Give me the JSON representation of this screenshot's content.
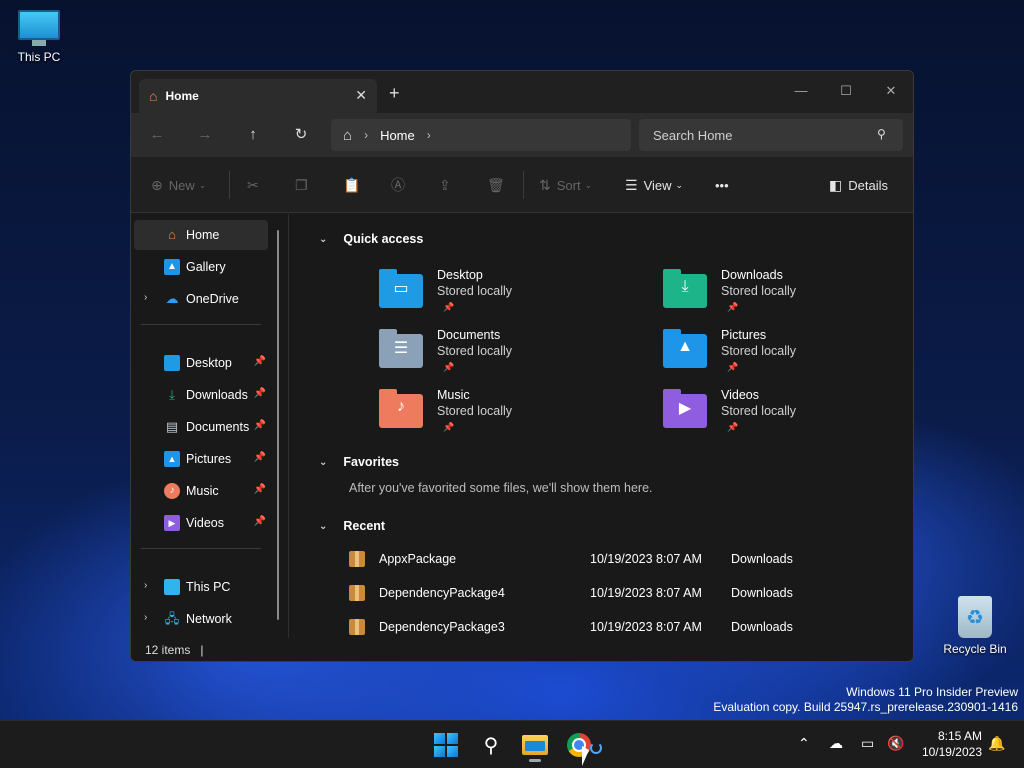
{
  "desktop": {
    "this_pc_label": "This PC",
    "recycle_bin_label": "Recycle Bin",
    "watermark_line1": "Windows 11 Pro Insider Preview",
    "watermark_line2": "Evaluation copy. Build 25947.rs_prerelease.230901-1416"
  },
  "window": {
    "tab_title": "Home",
    "tab_close_glyph": "✕",
    "new_tab_glyph": "+",
    "address": {
      "crumb": "Home"
    },
    "search": {
      "placeholder": "Search Home"
    }
  },
  "toolbar": {
    "new_label": "New",
    "sort_label": "Sort",
    "view_label": "View",
    "more_label": "•••",
    "details_label": "Details"
  },
  "navpane": {
    "top": [
      {
        "label": "Home",
        "icon": "home-icon"
      },
      {
        "label": "Gallery",
        "icon": "gallery-icon"
      },
      {
        "label": "OneDrive",
        "icon": "onedrive-icon"
      }
    ],
    "pinned": [
      {
        "label": "Desktop",
        "icon": "desktop-folder-icon"
      },
      {
        "label": "Downloads",
        "icon": "downloads-folder-icon"
      },
      {
        "label": "Documents",
        "icon": "documents-folder-icon"
      },
      {
        "label": "Pictures",
        "icon": "pictures-folder-icon"
      },
      {
        "label": "Music",
        "icon": "music-folder-icon"
      },
      {
        "label": "Videos",
        "icon": "videos-folder-icon"
      }
    ],
    "bottom": [
      {
        "label": "This PC",
        "icon": "this-pc-icon"
      },
      {
        "label": "Network",
        "icon": "network-icon"
      }
    ]
  },
  "content": {
    "quick_access_title": "Quick access",
    "quick_access": [
      {
        "name": "Desktop",
        "sub": "Stored locally",
        "color": "#1f9be6"
      },
      {
        "name": "Downloads",
        "sub": "Stored locally",
        "color": "#1db489"
      },
      {
        "name": "Documents",
        "sub": "Stored locally",
        "color": "#8aa1b8"
      },
      {
        "name": "Pictures",
        "sub": "Stored locally",
        "color": "#1e95e8"
      },
      {
        "name": "Music",
        "sub": "Stored locally",
        "color": "#ef7b5e"
      },
      {
        "name": "Videos",
        "sub": "Stored locally",
        "color": "#8e5de0"
      }
    ],
    "favorites_title": "Favorites",
    "favorites_empty": "After you've favorited some files, we'll show them here.",
    "recent_title": "Recent",
    "recent": [
      {
        "name": "AppxPackage",
        "date": "10/19/2023 8:07 AM",
        "location": "Downloads"
      },
      {
        "name": "DependencyPackage4",
        "date": "10/19/2023 8:07 AM",
        "location": "Downloads"
      },
      {
        "name": "DependencyPackage3",
        "date": "10/19/2023 8:07 AM",
        "location": "Downloads"
      }
    ]
  },
  "status": {
    "items": "12 items"
  },
  "taskbar": {
    "time": "8:15 AM",
    "date": "10/19/2023"
  }
}
